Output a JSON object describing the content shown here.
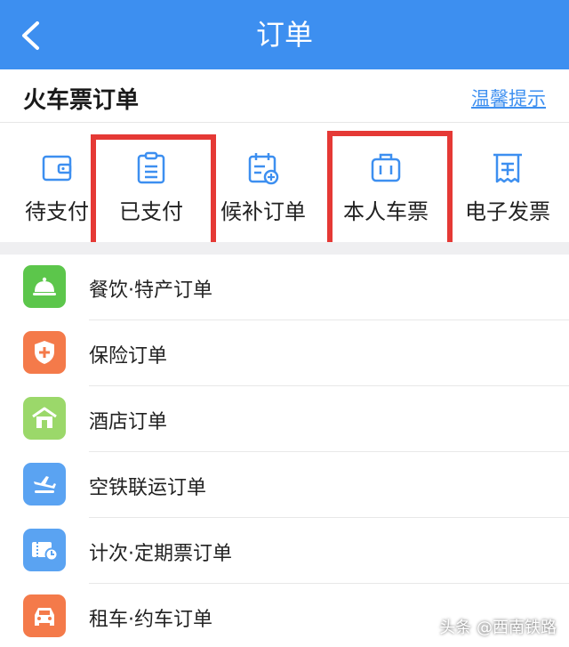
{
  "header": {
    "title": "订单",
    "back_icon": "chevron-left-icon"
  },
  "section": {
    "title": "火车票订单",
    "tips_link": "温馨提示"
  },
  "quick_actions": [
    {
      "label": "待支付",
      "icon": "wallet-icon"
    },
    {
      "label": "已支付",
      "icon": "clipboard-icon"
    },
    {
      "label": "候补订单",
      "icon": "calendar-add-icon"
    },
    {
      "label": "本人车票",
      "icon": "luggage-icon"
    },
    {
      "label": "电子发票",
      "icon": "receipt-icon"
    }
  ],
  "orders": [
    {
      "label": "餐饮·特产订单",
      "icon": "bell-cloche-icon",
      "color": "#5cc64b"
    },
    {
      "label": "保险订单",
      "icon": "shield-plus-icon",
      "color": "#f47a4a"
    },
    {
      "label": "酒店订单",
      "icon": "hotel-icon",
      "color": "#9bd86a"
    },
    {
      "label": "空铁联运订单",
      "icon": "plane-train-icon",
      "color": "#5aa3f2"
    },
    {
      "label": "计次·定期票订单",
      "icon": "ticket-clock-icon",
      "color": "#5aa3f2"
    },
    {
      "label": "租车·约车订单",
      "icon": "car-icon",
      "color": "#f47a4a"
    }
  ],
  "watermark": "头条 @西南铁路",
  "colors": {
    "primary": "#3d8ff0",
    "highlight": "#e53935"
  }
}
